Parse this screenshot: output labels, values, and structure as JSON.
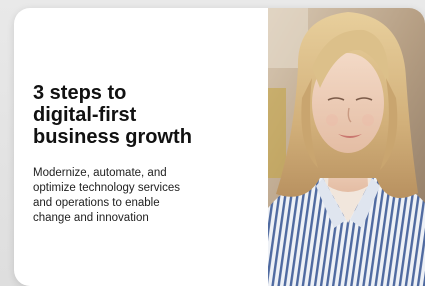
{
  "card": {
    "headline_lines": [
      "3 steps to",
      "digital-first",
      "business growth"
    ],
    "body_lines": [
      "Modernize, automate, and",
      "optimize technology services",
      "and operations to enable",
      "change and innovation"
    ]
  },
  "photo": {
    "icon": "woman-portrait-photo"
  },
  "colors": {
    "card_background": "#ffffff",
    "headline": "#111111",
    "body": "#222222",
    "page_background": "#ececec"
  }
}
